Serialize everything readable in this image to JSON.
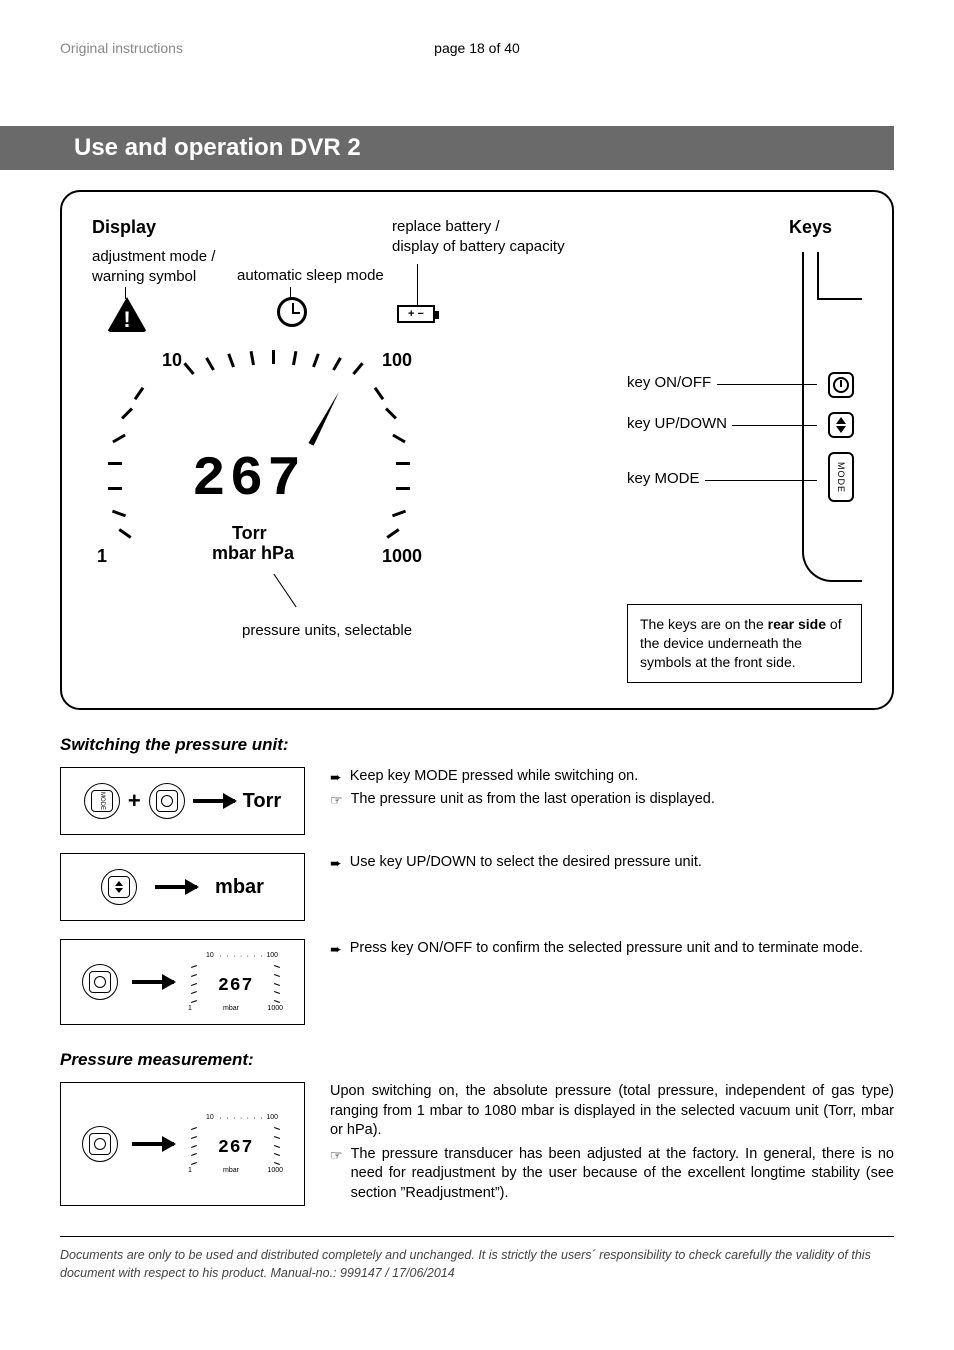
{
  "header": {
    "left": "Original instructions",
    "center": "page 18 of 40"
  },
  "section_title": "Use and operation DVR 2",
  "diagram": {
    "display_heading": "Display",
    "keys_heading": "Keys",
    "replace_battery_label": "replace battery /\ndisplay of battery capacity",
    "adjustment_label": "adjustment mode /\nwarning symbol",
    "sleep_label": "automatic sleep mode",
    "units_caption": "pressure units, selectable",
    "battery_icon_text": "+  −",
    "gauge": {
      "scale_10": "10",
      "scale_100": "100",
      "scale_1": "1",
      "scale_1000": "1000",
      "reading": "267",
      "unit_torr": "Torr",
      "unit_mbarhpa": "mbar hPa"
    },
    "key_labels": {
      "onoff": "key ON/OFF",
      "updown": "key UP/DOWN",
      "mode": "key MODE",
      "mode_button_text": "MODE"
    },
    "keys_note_pre": "The keys are on the ",
    "keys_note_bold": "rear side",
    "keys_note_post": " of the device underneath the symbols at the front side."
  },
  "switching": {
    "heading": "Switching the pressure unit:",
    "steps": [
      {
        "plus": "+",
        "result": "Torr",
        "lines": [
          {
            "bullet": "➨",
            "text": "Keep key MODE pressed while switching on."
          },
          {
            "bullet": "☞",
            "text": "The pressure unit as from the last operation is displayed."
          }
        ]
      },
      {
        "result": "mbar",
        "lines": [
          {
            "bullet": "➨",
            "text": "Use key UP/DOWN to select the desired pressure unit."
          }
        ]
      },
      {
        "lines": [
          {
            "bullet": "➨",
            "text": "Press key ON/OFF to confirm the selected pressure unit and to terminate mode."
          }
        ]
      }
    ]
  },
  "measurement": {
    "heading": "Pressure measurement:",
    "intro": "Upon switching on, the absolute pressure (total pressure, independent of gas type) ranging from 1 mbar to 1080 mbar is displayed in the selected vacuum unit (Torr, mbar or hPa).",
    "note_bullet": "☞",
    "note": "The pressure transducer has been adjusted at the factory. In general, there is no need for readjustment by the user because of the excellent longtime stability (see section ”Readjustment”)."
  },
  "mini_gauge": {
    "scale_10": "10",
    "scale_100": "100",
    "scale_1": "1",
    "scale_1000": "1000",
    "reading": "267",
    "unit": "mbar",
    "ticks_top": "' ' ' ' ' ' '"
  },
  "footnote": "Documents are only to be used and distributed completely and unchanged. It is strictly the users´ responsibility to check carefully the validity of this document with respect to his product. Manual-no.: 999147 / 17/06/2014"
}
